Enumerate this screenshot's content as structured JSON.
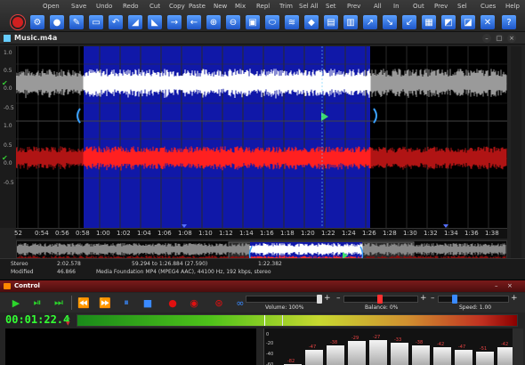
{
  "toolbar": {
    "labels": [
      "Open",
      "Save",
      "Undo",
      "Redo",
      "Cut",
      "Copy",
      "Paste",
      "New",
      "Mix",
      "Repl",
      "Trim",
      "Sel All",
      "Set",
      "Prev",
      "All",
      "In",
      "Out",
      "Prev",
      "Sel",
      "Cues",
      "Help"
    ],
    "icons": [
      "stop-record-icon",
      "record-settings-icon",
      "marker-icon",
      "pencil-icon",
      "crop-icon",
      "undo-icon",
      "fade-in-icon",
      "fade-out-icon",
      "arrow-in-icon",
      "arrow-out-icon",
      "zoom-icon",
      "normalize-icon",
      "amplify-icon",
      "reverse-icon",
      "effects-icon",
      "cube-icon",
      "eq-icon",
      "cue-icon",
      "snap-icon",
      "spectrum-icon",
      "chart-icon",
      "time-icon",
      "bookmark-icon",
      "select-icon",
      "clear-icon",
      "help-icon"
    ]
  },
  "editor": {
    "title": "Music.m4a",
    "scale": [
      "1.0",
      "0.5",
      "0.0",
      "-0.5",
      "1.0",
      "0.5",
      "0.0",
      "-0.5"
    ],
    "timeline": [
      "52",
      "0:54",
      "0:56",
      "0:58",
      "1:00",
      "1:02",
      "1:04",
      "1:06",
      "1:08",
      "1:10",
      "1:12",
      "1:14",
      "1:16",
      "1:18",
      "1:20",
      "1:22",
      "1:24",
      "1:26",
      "1:28",
      "1:30",
      "1:32",
      "1:34",
      "1:36",
      "1:38"
    ],
    "overview_timeline": [
      "0:00",
      "0:05",
      "0:10",
      "0:15",
      "0:20",
      "0:25",
      "0:30",
      "0:35",
      "0:40",
      "0:45",
      "0:50",
      "0:55",
      "1:00",
      "1:05",
      "1:10",
      "1:15",
      "1:20",
      "1:25",
      "1:30",
      "1:35",
      "1:40",
      "1:45",
      "1:50",
      "1:55",
      "2:00"
    ]
  },
  "status": {
    "channels": "Stereo",
    "length": "2:02.578",
    "selection": "59.294 to 1:26.884 (27.590)",
    "cursor": "1:22.382",
    "state": "Modified",
    "size": "46.866",
    "format": "Media Foundation MP4 (MPEG4 AAC), 44100 Hz, 192 kbps, stereo"
  },
  "control": {
    "title": "Control",
    "volume_label": "Volume: 100%",
    "balance_label": "Balance: 0%",
    "speed_label": "Speed: 1.00",
    "timecode": "00:01:22.4",
    "db_labels": [
      "0",
      "-20",
      "-40",
      "-60"
    ],
    "bar_values": [
      "-82",
      "-47",
      "-38",
      "-29",
      "-27",
      "-33",
      "-38",
      "-42",
      "-47",
      "-51",
      "-42"
    ]
  },
  "colors": {
    "selection": "#1018a8",
    "wave_left": "#ffffff",
    "wave_right": "#ff2020",
    "timecode": "#33ff33"
  }
}
